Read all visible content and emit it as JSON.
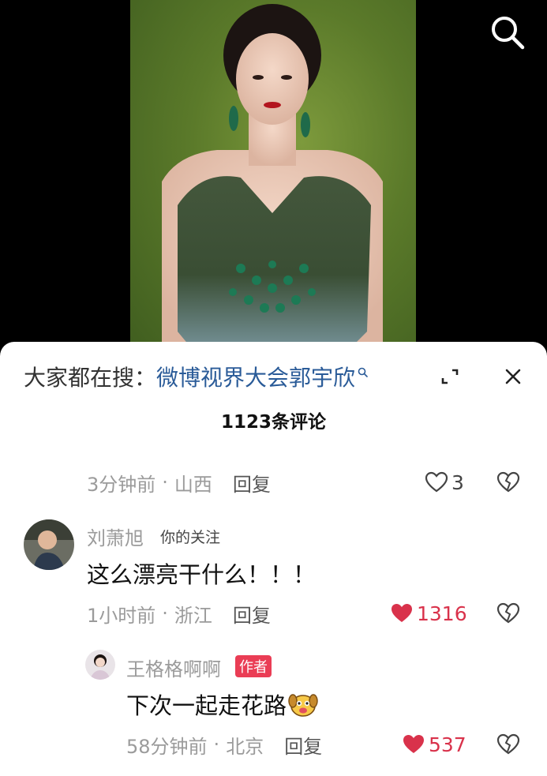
{
  "hot_search": {
    "prefix": "大家都在搜：",
    "keyword": "微博视界大会郭宇欣"
  },
  "comment_count": "1123条评论",
  "comments": [
    {
      "time": "3分钟前",
      "separator": "·",
      "location": "山西",
      "reply_label": "回复",
      "likes": "3",
      "liked": false
    },
    {
      "username": "刘萧旭",
      "follow_tag": "你的关注",
      "text": "这么漂亮干什么！！！",
      "time": "1小时前",
      "separator": "·",
      "location": "浙江",
      "reply_label": "回复",
      "likes": "1316",
      "liked": true
    },
    {
      "username": "王格格啊啊",
      "badge": "作者",
      "text": "下次一起走花路",
      "time": "58分钟前",
      "separator": "·",
      "location": "北京",
      "reply_label": "回复",
      "likes": "537",
      "liked": true
    }
  ],
  "colors": {
    "accent_red": "#d9324b",
    "link_blue": "#2a5b98",
    "badge_red": "#ea3d55",
    "photo_background": "#5b7a2a"
  },
  "icons": {
    "search": "search-icon",
    "expand": "expand-icon",
    "close": "close-icon",
    "like": "heart-icon",
    "dislike": "broken-heart-icon",
    "emoji": "dog-emoji-icon"
  }
}
